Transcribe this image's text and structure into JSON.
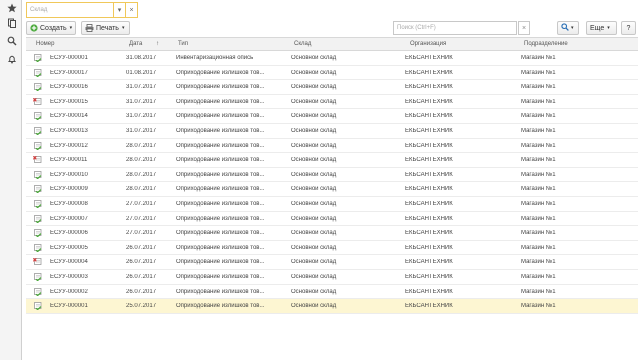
{
  "sidebar": {
    "icons": [
      "star-icon",
      "document-icon",
      "search-icon",
      "bell-icon"
    ]
  },
  "filter": {
    "warehouse_placeholder": "Склад"
  },
  "toolbar": {
    "create_label": "Создать",
    "print_label": "Печать",
    "search_placeholder": "Поиск (Ctrl+F)",
    "search_clear": "×",
    "more_label": "Еще",
    "help_label": "?"
  },
  "table": {
    "headers": {
      "number": "Номер",
      "date": "Дата",
      "sort_indicator": "↑",
      "type": "Тип",
      "warehouse": "Склад",
      "organization": "Организация",
      "division": "Подразделение"
    },
    "rows": [
      {
        "status": "posted",
        "number": "ЕСУУ-000001",
        "date": "31.08.2017",
        "type": "Инвентаризационная опись",
        "warehouse": "Основной склад",
        "organization": "ЕКБСАНТЕХНИК",
        "division": "Магазин №1"
      },
      {
        "status": "posted",
        "number": "ЕСУУ-000017",
        "date": "01.08.2017",
        "type": "Оприходование излишков тов...",
        "warehouse": "Основной склад",
        "organization": "ЕКБСАНТЕХНИК",
        "division": "Магазин №1"
      },
      {
        "status": "posted",
        "number": "ЕСУУ-000016",
        "date": "31.07.2017",
        "type": "Оприходование излишков тов...",
        "warehouse": "Основной склад",
        "organization": "ЕКБСАНТЕХНИК",
        "division": "Магазин №1"
      },
      {
        "status": "deleted",
        "number": "ЕСУУ-000015",
        "date": "31.07.2017",
        "type": "Оприходование излишков тов...",
        "warehouse": "Основной склад",
        "organization": "ЕКБСАНТЕХНИК",
        "division": "Магазин №1"
      },
      {
        "status": "posted",
        "number": "ЕСУУ-000014",
        "date": "31.07.2017",
        "type": "Оприходование излишков тов...",
        "warehouse": "Основной склад",
        "organization": "ЕКБСАНТЕХНИК",
        "division": "Магазин №1"
      },
      {
        "status": "posted",
        "number": "ЕСУУ-000013",
        "date": "31.07.2017",
        "type": "Оприходование излишков тов...",
        "warehouse": "Основной склад",
        "organization": "ЕКБСАНТЕХНИК",
        "division": "Магазин №1"
      },
      {
        "status": "posted",
        "number": "ЕСУУ-000012",
        "date": "28.07.2017",
        "type": "Оприходование излишков тов...",
        "warehouse": "Основной склад",
        "organization": "ЕКБСАНТЕХНИК",
        "division": "Магазин №1"
      },
      {
        "status": "deleted",
        "number": "ЕСУУ-000011",
        "date": "28.07.2017",
        "type": "Оприходование излишков тов...",
        "warehouse": "Основной склад",
        "organization": "ЕКБСАНТЕХНИК",
        "division": "Магазин №1"
      },
      {
        "status": "posted",
        "number": "ЕСУУ-000010",
        "date": "28.07.2017",
        "type": "Оприходование излишков тов...",
        "warehouse": "Основной склад",
        "organization": "ЕКБСАНТЕХНИК",
        "division": "Магазин №1"
      },
      {
        "status": "posted",
        "number": "ЕСУУ-000009",
        "date": "28.07.2017",
        "type": "Оприходование излишков тов...",
        "warehouse": "Основной склад",
        "organization": "ЕКБСАНТЕХНИК",
        "division": "Магазин №1"
      },
      {
        "status": "posted",
        "number": "ЕСУУ-000008",
        "date": "27.07.2017",
        "type": "Оприходование излишков тов...",
        "warehouse": "Основной склад",
        "organization": "ЕКБСАНТЕХНИК",
        "division": "Магазин №1"
      },
      {
        "status": "posted",
        "number": "ЕСУУ-000007",
        "date": "27.07.2017",
        "type": "Оприходование излишков тов...",
        "warehouse": "Основной склад",
        "organization": "ЕКБСАНТЕХНИК",
        "division": "Магазин №1"
      },
      {
        "status": "posted",
        "number": "ЕСУУ-000006",
        "date": "27.07.2017",
        "type": "Оприходование излишков тов...",
        "warehouse": "Основной склад",
        "organization": "ЕКБСАНТЕХНИК",
        "division": "Магазин №1"
      },
      {
        "status": "posted",
        "number": "ЕСУУ-000005",
        "date": "26.07.2017",
        "type": "Оприходование излишков тов...",
        "warehouse": "Основной склад",
        "organization": "ЕКБСАНТЕХНИК",
        "division": "Магазин №1"
      },
      {
        "status": "deleted",
        "number": "ЕСУУ-000004",
        "date": "26.07.2017",
        "type": "Оприходование излишков тов...",
        "warehouse": "Основной склад",
        "organization": "ЕКБСАНТЕХНИК",
        "division": "Магазин №1"
      },
      {
        "status": "posted",
        "number": "ЕСУУ-000003",
        "date": "26.07.2017",
        "type": "Оприходование излишков тов...",
        "warehouse": "Основной склад",
        "organization": "ЕКБСАНТЕХНИК",
        "division": "Магазин №1"
      },
      {
        "status": "posted",
        "number": "ЕСУУ-000002",
        "date": "26.07.2017",
        "type": "Оприходование излишков тов...",
        "warehouse": "Основной склад",
        "organization": "ЕКБСАНТЕХНИК",
        "division": "Магазин №1"
      },
      {
        "status": "posted",
        "number": "ЕСУУ-000001",
        "date": "25.07.2017",
        "type": "Оприходование излишков тов...",
        "warehouse": "Основной склад",
        "organization": "ЕКБСАНТЕХНИК",
        "division": "Магазин №1",
        "selected": true
      }
    ]
  },
  "colors": {
    "accent": "#f0c85a",
    "selected_row": "#fdf6d2",
    "posted_icon": "#4caa3c",
    "deleted_icon": "#d83a3a"
  }
}
